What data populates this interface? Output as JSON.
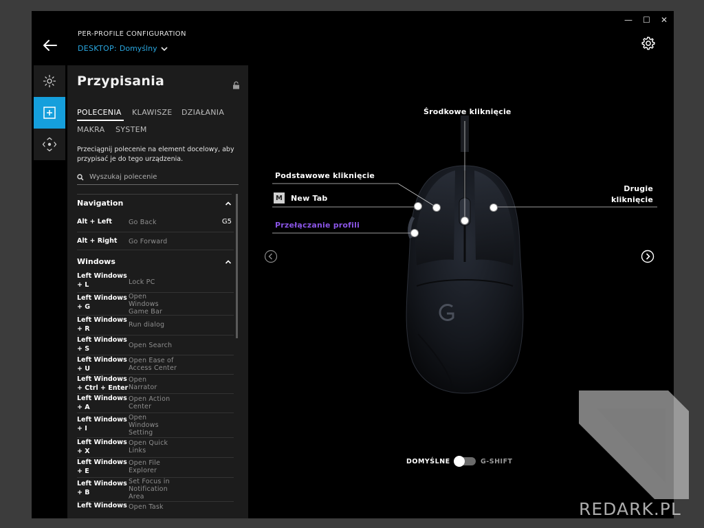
{
  "window": {
    "minimize": "—",
    "maximize": "☐",
    "close": "✕"
  },
  "header": {
    "title": "PER-PROFILE CONFIGURATION",
    "profile_label": "DESKTOP:",
    "profile_name": "Domyślny"
  },
  "rail": [
    {
      "icon": "lighting-icon",
      "active": false
    },
    {
      "icon": "assignments-icon",
      "active": true
    },
    {
      "icon": "dpi-move-icon",
      "active": false
    }
  ],
  "panel": {
    "title": "Przypisania",
    "tabs": [
      "POLECENIA",
      "KLAWISZE",
      "DZIAŁANIA",
      "MAKRA",
      "SYSTEM"
    ],
    "active_tab": "POLECENIA",
    "description": "Przeciągnij polecenie na element docelowy, aby przypisać je do tego urządzenia.",
    "search_placeholder": "Wyszukaj polecenie",
    "sections": [
      {
        "title": "Navigation",
        "rows": [
          {
            "key": "Alt + Left",
            "value": "Go Back",
            "button": "G5"
          },
          {
            "key": "Alt + Right",
            "value": "Go Forward",
            "button": ""
          }
        ]
      },
      {
        "title": "Windows",
        "rows": [
          {
            "key": "Left Windows + L",
            "value": "Lock PC",
            "button": ""
          },
          {
            "key": "Left Windows + G",
            "value": "Open Windows Game Bar",
            "button": ""
          },
          {
            "key": "Left Windows + R",
            "value": "Run dialog",
            "button": ""
          },
          {
            "key": "Left Windows + S",
            "value": "Open Search",
            "button": ""
          },
          {
            "key": "Left Windows + U",
            "value": "Open Ease of Access Center",
            "button": ""
          },
          {
            "key": "Left Windows + Ctrl + Enter",
            "value": "Open Narrator",
            "button": ""
          },
          {
            "key": "Left Windows + A",
            "value": "Open Action Center",
            "button": ""
          },
          {
            "key": "Left Windows + I",
            "value": "Open Windows Setting",
            "button": ""
          },
          {
            "key": "Left Windows + X",
            "value": "Open Quick Links",
            "button": ""
          },
          {
            "key": "Left Windows + E",
            "value": "Open File Explorer",
            "button": ""
          },
          {
            "key": "Left Windows + B",
            "value": "Set Focus in Notification Area",
            "button": ""
          },
          {
            "key": "Left Windows",
            "value": "Open Task",
            "button": ""
          }
        ]
      }
    ]
  },
  "mouse": {
    "middle_click": "Środkowe kliknięcie",
    "primary_click": "Podstawowe kliknięcie",
    "secondary_click": "Drugie kliknięcie",
    "new_tab_badge": "M",
    "new_tab": "New Tab",
    "profile_cycle": "Przełączanie profili"
  },
  "toggle": {
    "left_label": "DOMYŚLNE",
    "right_label": "G-SHIFT",
    "state": "off"
  },
  "watermark": {
    "text": "REDARK.PL"
  },
  "colors": {
    "accent": "#159fdc",
    "profile_link": "#8a55e6",
    "background": "#000000"
  }
}
